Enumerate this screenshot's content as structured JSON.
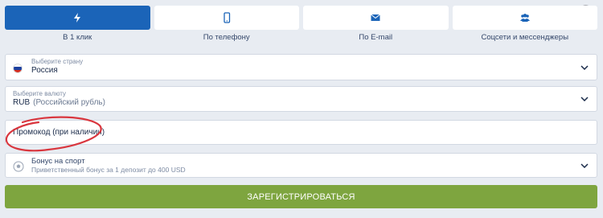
{
  "tabs": [
    {
      "label": "В 1 клик",
      "icon": "lightning-icon"
    },
    {
      "label": "По телефону",
      "icon": "phone-icon"
    },
    {
      "label": "По E-mail",
      "icon": "envelope-icon"
    },
    {
      "label": "Соцсети и мессенджеры",
      "icon": "users-icon"
    }
  ],
  "country": {
    "hint": "Выберите страну",
    "value": "Россия"
  },
  "currency": {
    "hint": "Выберите валюту",
    "code": "RUB",
    "name": "(Российский рубль)"
  },
  "promo": {
    "placeholder": "Промокод (при наличии)"
  },
  "bonus": {
    "title": "Бонус на спорт",
    "subtitle": "Приветственный бонус за 1 депозит до 400 USD"
  },
  "register_label": "ЗАРЕГИСТРИРОВАТЬСЯ",
  "colors": {
    "accent": "#1b64b8",
    "register": "#7ea53f",
    "annotation": "#d9363e"
  }
}
